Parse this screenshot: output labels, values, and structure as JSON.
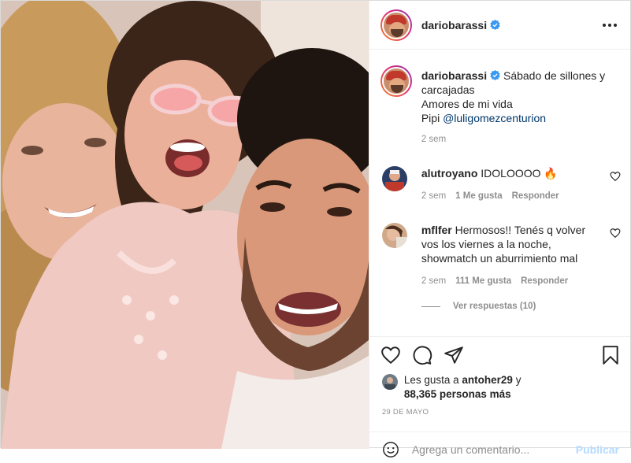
{
  "post": {
    "username": "dariobarassi",
    "more_label": "More options"
  },
  "caption": {
    "username": "dariobarassi",
    "line1": "Sábado de sillones y",
    "line2": "carcajadas",
    "line3": "Amores de mi vida",
    "pipi": "Pipi",
    "mention": "@luligomezcenturion",
    "time": "2 sem"
  },
  "comments": [
    {
      "username": "alutroyano",
      "text": "IDOLOOOO 🔥",
      "time": "2 sem",
      "likes": "1 Me gusta",
      "reply": "Responder"
    },
    {
      "username": "mflfer",
      "text_line1": "Hermosos!! Tenés q volver",
      "text_line2": "vos los viernes a la noche,",
      "text_line3": "showmatch un aburrimiento mal",
      "time": "2 sem",
      "likes": "111 Me gusta",
      "reply": "Responder"
    }
  ],
  "view_replies": "Ver respuestas (10)",
  "likes": {
    "prefix": "Les gusta a",
    "user": "antoher29",
    "conj": "y",
    "count": "88,365 personas más"
  },
  "date": "29 DE MAYO",
  "add_comment": {
    "placeholder": "Agrega un comentario...",
    "publish": "Publicar"
  },
  "colors": {
    "verified": "#3897f0",
    "link": "#00376b",
    "muted": "#8e8e8e",
    "publish_disabled": "#b3dbff"
  }
}
